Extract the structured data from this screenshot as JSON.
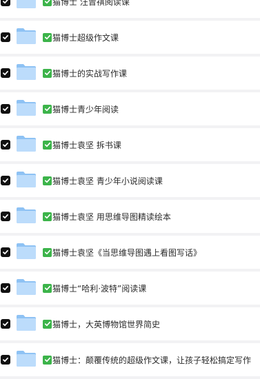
{
  "items": [
    {
      "checked": true,
      "icon": "folder-icon",
      "badge": "check-mark-emoji",
      "label": "猫博士 汪曾祺阅读课"
    },
    {
      "checked": true,
      "icon": "folder-icon",
      "badge": "check-mark-emoji",
      "label": "猫博士超级作文课"
    },
    {
      "checked": true,
      "icon": "folder-icon",
      "badge": "check-mark-emoji",
      "label": "猫博士的实战写作课"
    },
    {
      "checked": true,
      "icon": "folder-icon",
      "badge": "check-mark-emoji",
      "label": "猫博士青少年阅读"
    },
    {
      "checked": true,
      "icon": "folder-icon",
      "badge": "check-mark-emoji",
      "label": "猫博士袁坚 拆书课"
    },
    {
      "checked": true,
      "icon": "folder-icon",
      "badge": "check-mark-emoji",
      "label": "猫博士袁坚 青少年小说阅读课"
    },
    {
      "checked": true,
      "icon": "folder-icon",
      "badge": "check-mark-emoji",
      "label": "猫博士袁坚 用思维导图精读绘本"
    },
    {
      "checked": true,
      "icon": "folder-icon",
      "badge": "check-mark-emoji",
      "label": "猫博士袁坚《当思维导图遇上看图写话》"
    },
    {
      "checked": true,
      "icon": "folder-icon",
      "badge": "check-mark-emoji",
      "label": "猫博士“哈利·波特”阅读课"
    },
    {
      "checked": true,
      "icon": "folder-icon",
      "badge": "check-mark-emoji",
      "label": "猫博士，大英博物馆世界简史"
    },
    {
      "checked": true,
      "icon": "folder-icon",
      "badge": "check-mark-emoji",
      "label": "猫博士：颠覆传统的超级作文课，让孩子轻松搞定写作"
    }
  ],
  "colors": {
    "background": "#f2f2f4",
    "row": "#ffffff",
    "checkbox": "#111111",
    "folder_light": "#bcdcfb",
    "folder_dark": "#8ec2f4",
    "check_emoji": "#3cb44a",
    "text": "#2a2a2a"
  }
}
